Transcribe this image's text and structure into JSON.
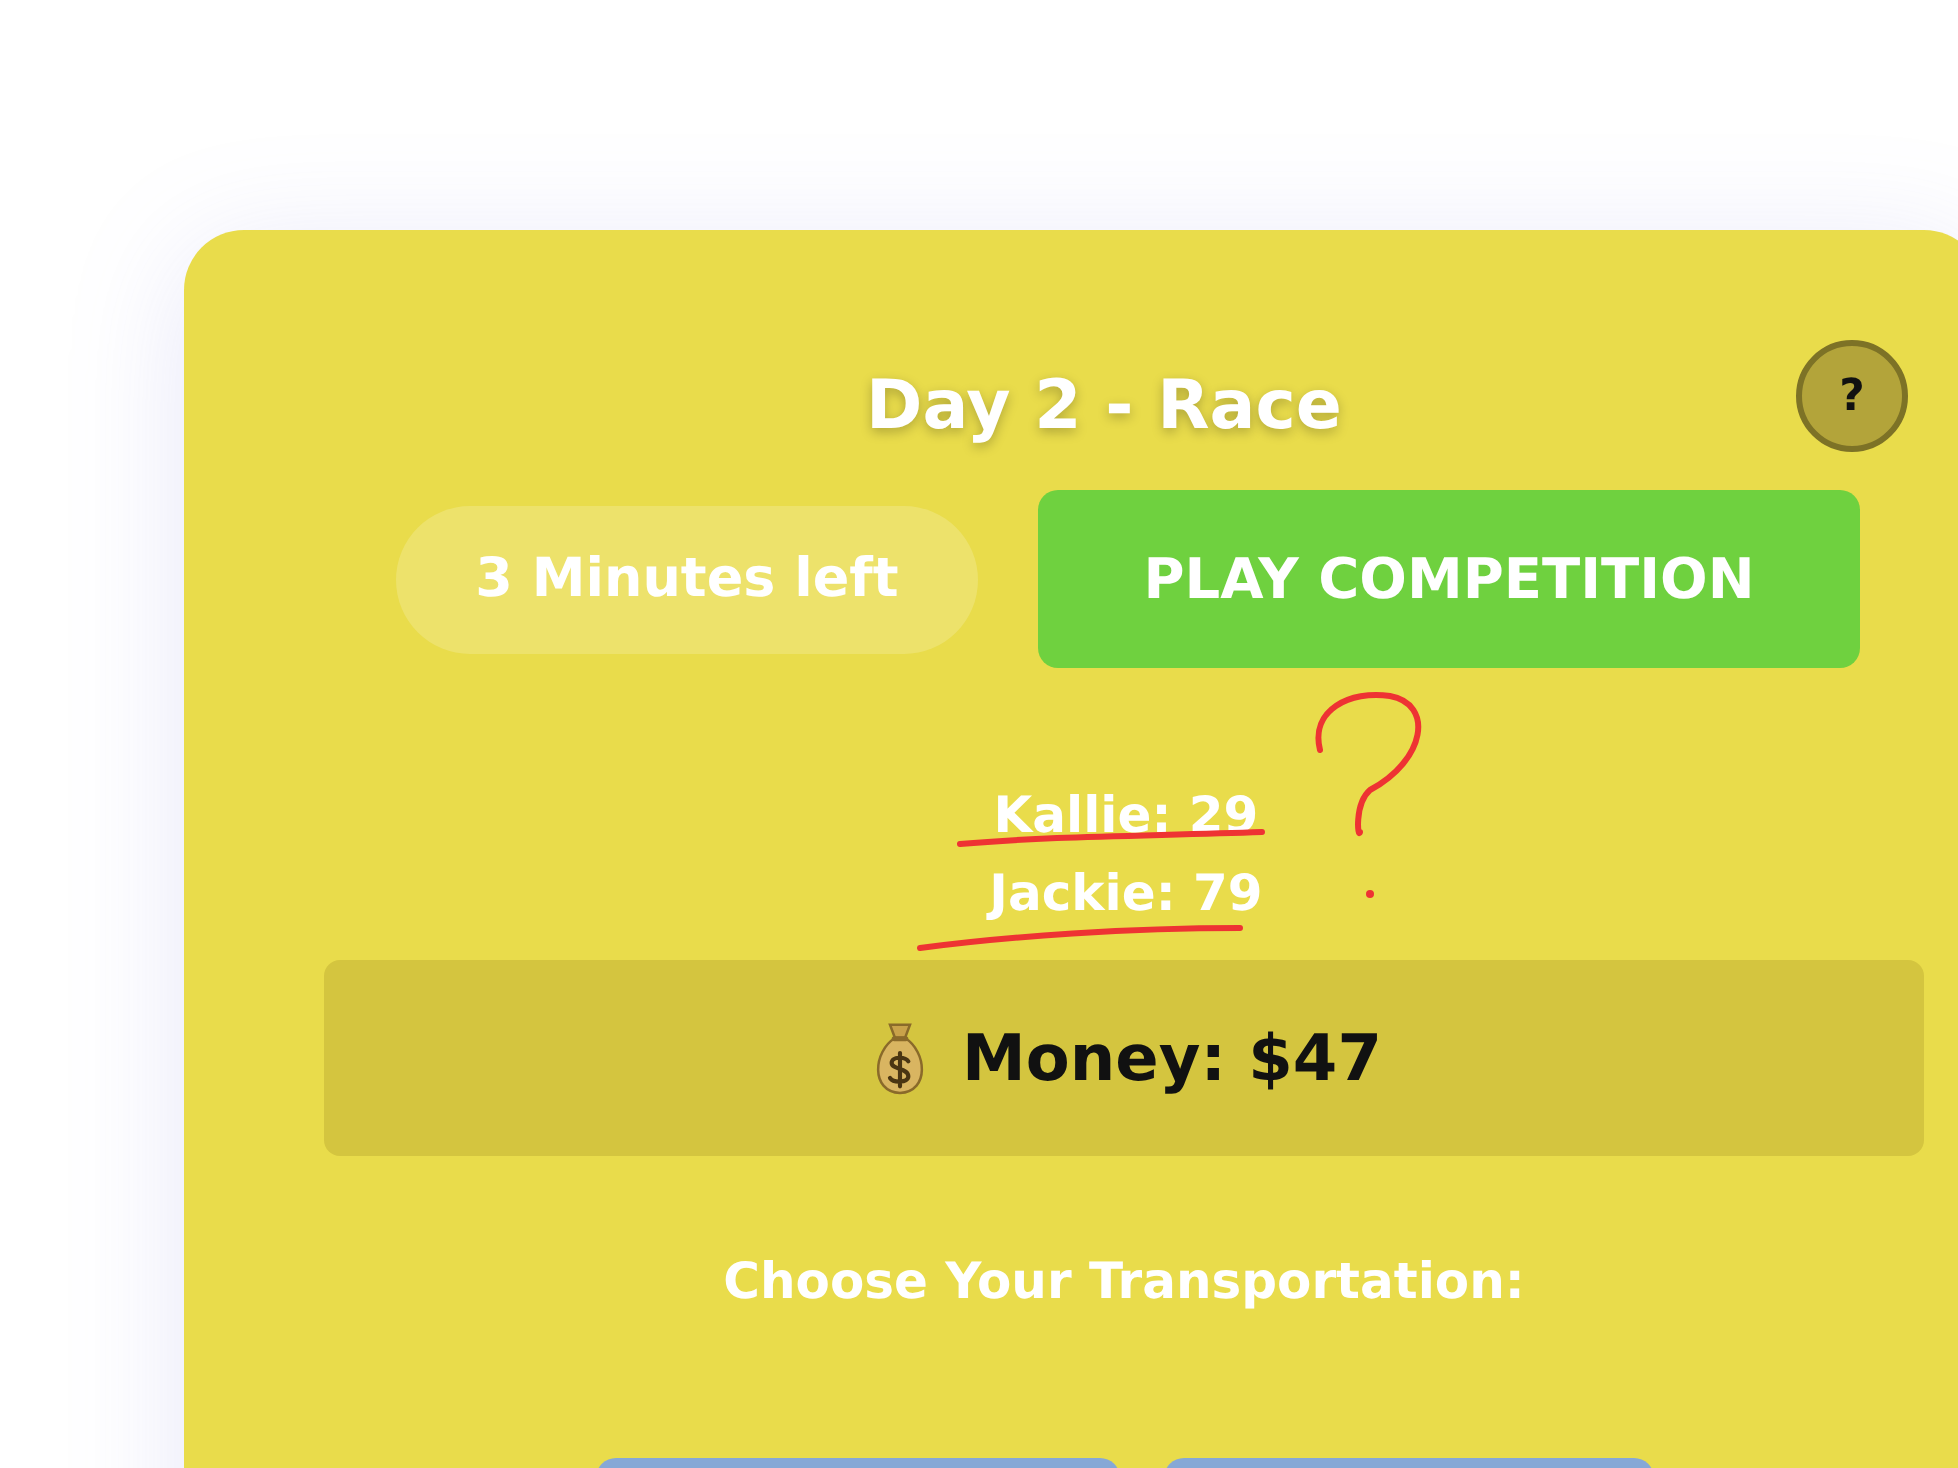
{
  "header": {
    "title": "Day 2 - Race",
    "help_label": "?"
  },
  "timer": {
    "label": "3 Minutes left"
  },
  "play_button": {
    "label": "PLAY COMPETITION"
  },
  "scores": [
    {
      "text": "Kallie: 29"
    },
    {
      "text": "Jackie: 79"
    }
  ],
  "money": {
    "label": "Money: $47"
  },
  "transportation": {
    "heading": "Choose Your Transportation:"
  }
}
